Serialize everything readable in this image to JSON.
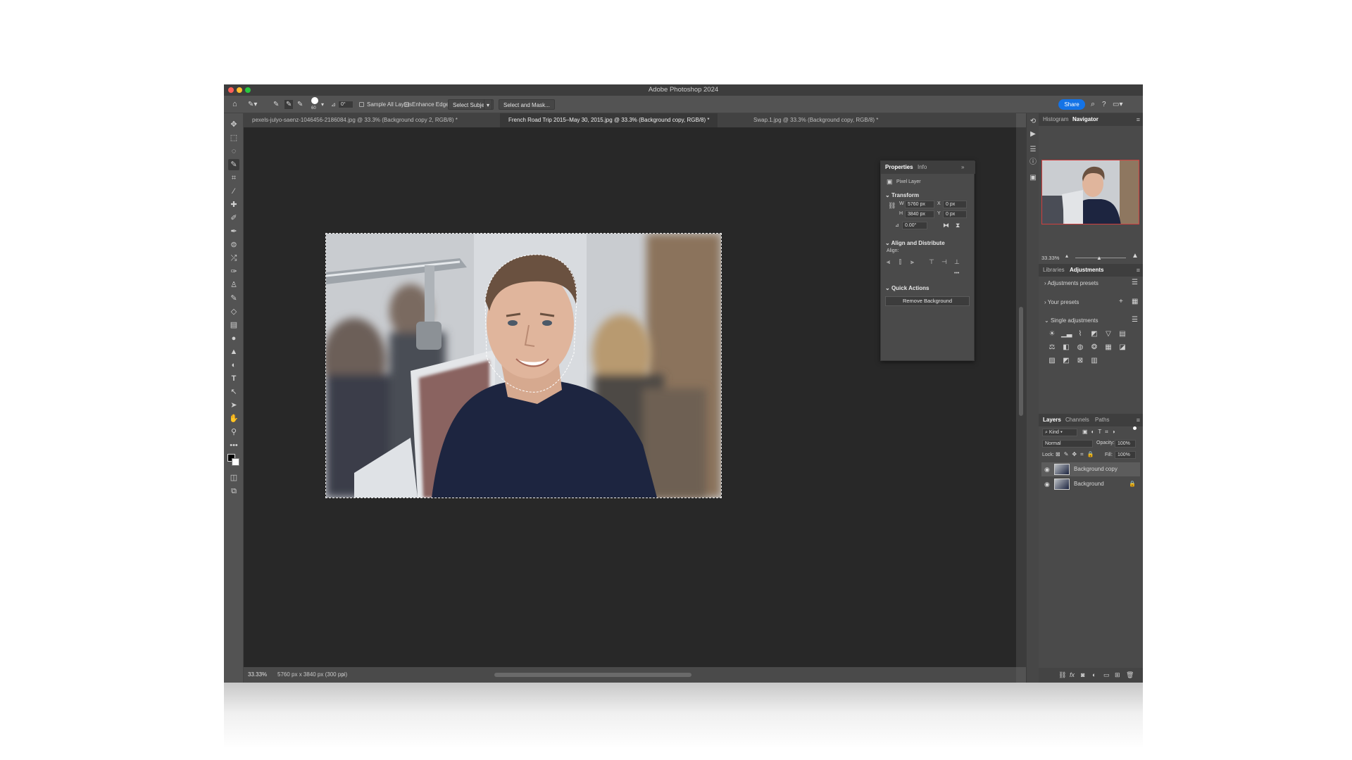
{
  "window": {
    "title": "Adobe Photoshop 2024"
  },
  "options_bar": {
    "brush_size": "60",
    "angle": "0°",
    "sample_all_layers": "Sample All Layers",
    "enhance_edge": "Enhance Edge",
    "select_subject": "Select Subject",
    "select_and_mask": "Select and Mask...",
    "share": "Share"
  },
  "doc_tabs": [
    {
      "label": "pexels-julyo-saenz-1046456-2186084.jpg @ 33.3% (Background copy 2, RGB/8) *"
    },
    {
      "label": "French Road Trip 2015–May 30, 2015.jpg @ 33.3% (Background copy, RGB/8) *"
    },
    {
      "label": "Swap.1.jpg @ 33.3% (Background copy, RGB/8) *"
    }
  ],
  "status": {
    "zoom": "33.33%",
    "doc_info": "5760 px x 3840 px (300 ppi)"
  },
  "properties": {
    "tabs": [
      "Properties",
      "Info"
    ],
    "layer_type": "Pixel Layer",
    "transform_title": "Transform",
    "w_label": "W",
    "w": "5760 px",
    "h_label": "H",
    "h": "3840 px",
    "x_label": "X",
    "x": "0 px",
    "y_label": "Y",
    "y": "0 px",
    "angle": "0.00°",
    "align_title": "Align and Distribute",
    "align_label": "Align:",
    "more": "•••",
    "quick_actions_title": "Quick Actions",
    "remove_background": "Remove Background"
  },
  "navigator": {
    "tabs": [
      "Histogram",
      "Navigator"
    ],
    "zoom": "33.33%"
  },
  "adjustments": {
    "tabs": [
      "Libraries",
      "Adjustments"
    ],
    "presets": "Adjustments presets",
    "your_presets": "Your presets",
    "single": "Single adjustments"
  },
  "layers": {
    "tabs": [
      "Layers",
      "Channels",
      "Paths"
    ],
    "filter_kind": "Kind",
    "blend_mode": "Normal",
    "opacity_label": "Opacity:",
    "opacity": "100%",
    "lock_label": "Lock:",
    "fill_label": "Fill:",
    "fill": "100%",
    "items": [
      {
        "name": "Background copy"
      },
      {
        "name": "Background"
      }
    ]
  },
  "colors": {
    "accent": "#1473e6",
    "canvas": "#282828",
    "panel": "#4a4a4a"
  }
}
